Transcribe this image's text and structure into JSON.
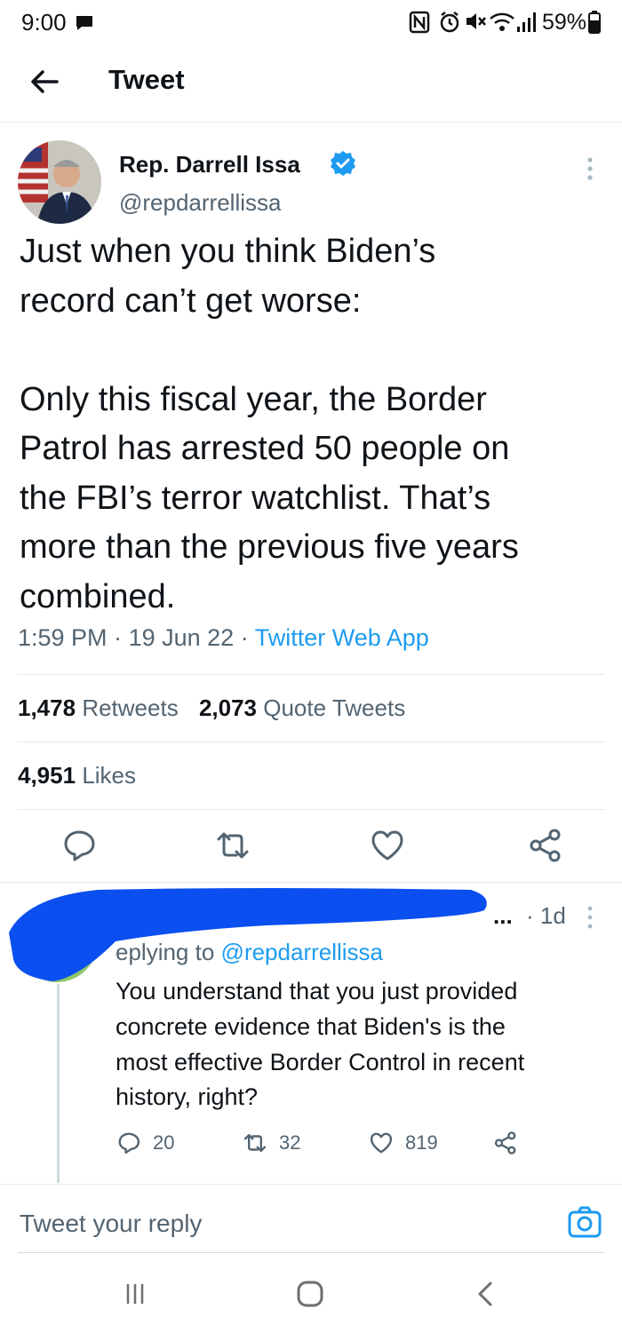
{
  "status_bar": {
    "time": "9:00",
    "battery": "59%",
    "icons": [
      "message-icon",
      "nfc-icon",
      "alarm-icon",
      "mute-icon",
      "wifi-icon",
      "signal-icon",
      "battery-icon"
    ]
  },
  "header": {
    "title": "Tweet",
    "back_icon": "back-arrow-icon"
  },
  "tweet": {
    "author_name": "Rep. Darrell Issa",
    "author_handle": "@repdarrellissa",
    "verified": true,
    "text": "Just when you think Biden’s\nrecord can’t get worse:\n\nOnly this fiscal year, the Border\nPatrol has arrested 50 people on\nthe FBI’s terror watchlist. That’s\nmore than the previous five years\ncombined.",
    "time": "1:59 PM",
    "date": "19 Jun 22",
    "separator": "·",
    "source": "Twitter Web App",
    "retweets_count": "1,478",
    "retweets_label": "Retweets",
    "quotes_count": "2,073",
    "quotes_label": "Quote Tweets",
    "likes_count": "4,951",
    "likes_label": "Likes",
    "actions": [
      "reply-icon",
      "retweet-icon",
      "like-icon",
      "share-icon"
    ]
  },
  "reply": {
    "ellipsis": "...",
    "time": "· 1d",
    "replying_prefix": "eplying to",
    "replying_handle": "@repdarrellissa",
    "text": "You understand that you just provided\nconcrete evidence that Biden's is the\nmost effective Border Control in recent\nhistory, right?",
    "reply_count": "20",
    "retweet_count": "32",
    "like_count": "819"
  },
  "compose": {
    "placeholder": "Tweet your reply"
  },
  "nav_bar": {
    "buttons": [
      "recent-apps-icon",
      "home-icon",
      "back-icon"
    ]
  },
  "colors": {
    "accent": "#1d9bf0",
    "text": "#0f1419",
    "muted": "#536471",
    "divider": "#e7e9ea",
    "redaction": "#0b4ff0"
  }
}
